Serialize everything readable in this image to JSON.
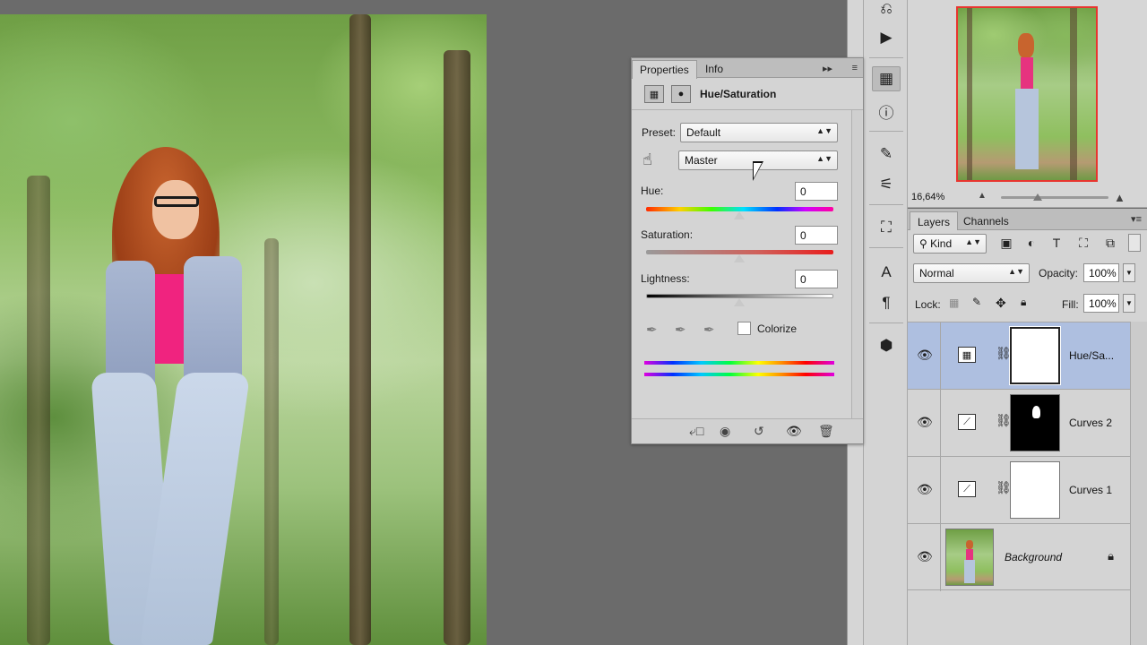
{
  "properties": {
    "tabs": [
      {
        "label": "Properties",
        "active": true
      },
      {
        "label": "Info",
        "active": false
      }
    ],
    "collapse_icon": "double-chevron-right-icon",
    "menu_icon": "panel-menu-icon",
    "title": "Hue/Saturation",
    "preset_label": "Preset:",
    "preset_value": "Default",
    "channel_value": "Master",
    "hue_label": "Hue:",
    "hue_value": "0",
    "saturation_label": "Saturation:",
    "saturation_value": "0",
    "lightness_label": "Lightness:",
    "lightness_value": "0",
    "colorize_label": "Colorize",
    "colorize_checked": false
  },
  "layers_panel": {
    "tabs": [
      {
        "label": "Layers",
        "active": true
      },
      {
        "label": "Channels",
        "active": false
      }
    ],
    "filter_kind": "Kind",
    "blend_mode": "Normal",
    "opacity_label": "Opacity:",
    "opacity_value": "100%",
    "lock_label": "Lock:",
    "fill_label": "Fill:",
    "fill_value": "100%",
    "layers": [
      {
        "name": "Hue/Sa...",
        "type": "hue-saturation",
        "selected": true,
        "visible": true
      },
      {
        "name": "Curves 2",
        "type": "curves",
        "selected": false,
        "visible": true
      },
      {
        "name": "Curves 1",
        "type": "curves",
        "selected": false,
        "visible": true
      },
      {
        "name": "Background",
        "type": "image",
        "selected": false,
        "visible": true,
        "locked": true
      }
    ]
  },
  "navigator": {
    "zoom": "16,64%"
  },
  "colors": {
    "panel_bg": "#d4d4d4",
    "selected_layer": "#aebfe0",
    "nav_frame": "#e8352f"
  }
}
